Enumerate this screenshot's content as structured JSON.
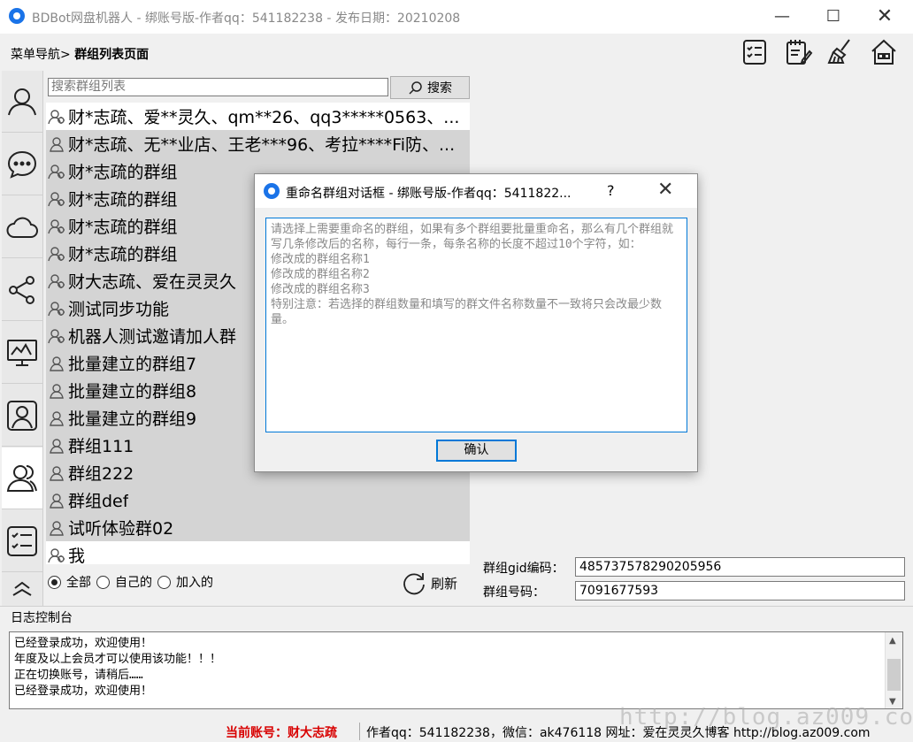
{
  "window": {
    "title": "BDBot网盘机器人 - 绑账号版-作者qq：541182238 - 发布日期：20210208",
    "minimize": "—",
    "maximize": "☐",
    "close": "✕"
  },
  "breadcrumb": {
    "root": "菜单导航>",
    "current": "群组列表页面"
  },
  "toolbar": [
    "checklist-icon",
    "notepad-icon",
    "broom-icon",
    "home-icon"
  ],
  "leftnav": [
    {
      "icon": "user-icon",
      "active": false
    },
    {
      "icon": "chat-icon",
      "active": false
    },
    {
      "icon": "cloud-icon",
      "active": false
    },
    {
      "icon": "share-icon",
      "active": false
    },
    {
      "icon": "monitor-chart-icon",
      "active": false
    },
    {
      "icon": "contact-card-icon",
      "active": false
    },
    {
      "icon": "group-user-icon",
      "active": true
    },
    {
      "icon": "task-list-icon",
      "active": false
    }
  ],
  "search": {
    "placeholder": "搜索群组列表",
    "button_label": "搜索"
  },
  "groups": [
    {
      "name": "财*志疏、爱**灵久、qm**26、qq3*****0563、...",
      "selected": false,
      "multi": true
    },
    {
      "name": "财*志疏、无**业店、王老***96、考拉****Fi防、...",
      "selected": true,
      "multi": false
    },
    {
      "name": "财*志疏的群组",
      "selected": true,
      "multi": true
    },
    {
      "name": "财*志疏的群组",
      "selected": true,
      "multi": true
    },
    {
      "name": "财*志疏的群组",
      "selected": true,
      "multi": true
    },
    {
      "name": "财*志疏的群组",
      "selected": true,
      "multi": true
    },
    {
      "name": "财大志疏、爱在灵灵久",
      "selected": true,
      "multi": true
    },
    {
      "name": "测试同步功能",
      "selected": true,
      "multi": true
    },
    {
      "name": "机器人测试邀请加人群",
      "selected": true,
      "multi": true
    },
    {
      "name": "批量建立的群组7",
      "selected": true,
      "multi": false
    },
    {
      "name": "批量建立的群组8",
      "selected": true,
      "multi": false
    },
    {
      "name": "批量建立的群组9",
      "selected": true,
      "multi": false
    },
    {
      "name": "群组111",
      "selected": true,
      "multi": false
    },
    {
      "name": "群组222",
      "selected": true,
      "multi": false
    },
    {
      "name": "群组def",
      "selected": true,
      "multi": false
    },
    {
      "name": "试听体验群02",
      "selected": true,
      "multi": false
    },
    {
      "name": "我",
      "selected": false,
      "multi": true
    }
  ],
  "filter": {
    "all": "全部",
    "mine": "自己的",
    "joined": "加入的",
    "selected": "all",
    "refresh": "刷新"
  },
  "detail": {
    "gid_label": "群组gid编码：",
    "gid_value": "485737578290205956",
    "num_label": "群组号码：",
    "num_value": "7091677593"
  },
  "log": {
    "title": "日志控制台",
    "lines": [
      "已经登录成功，欢迎使用！",
      "年度及以上会员才可以使用该功能！！！",
      "正在切换账号，请稍后……",
      "已经登录成功，欢迎使用！"
    ]
  },
  "status": {
    "account": "当前账号：财大志疏",
    "info": "作者qq：541182238，微信：ak476118 网址：爱在灵灵久博客 http://blog.az009.com"
  },
  "watermark": "http://blog.az009.com",
  "dialog": {
    "title": "重命名群组对话框 - 绑账号版-作者qq：5411822...",
    "help": "?",
    "close": "✕",
    "text": "请选择上需要重命名的群组，如果有多个群组要批量重命名，那么有几个群组就写几条修改后的名称，每行一条，每条名称的长度不超过10个字符，如：\n修改成的群组名称1\n修改成的群组名称2\n修改成的群组名称3\n特别注意：若选择的群组数量和填写的群文件名称数量不一致将只会改最少数量。",
    "ok": "确认"
  }
}
